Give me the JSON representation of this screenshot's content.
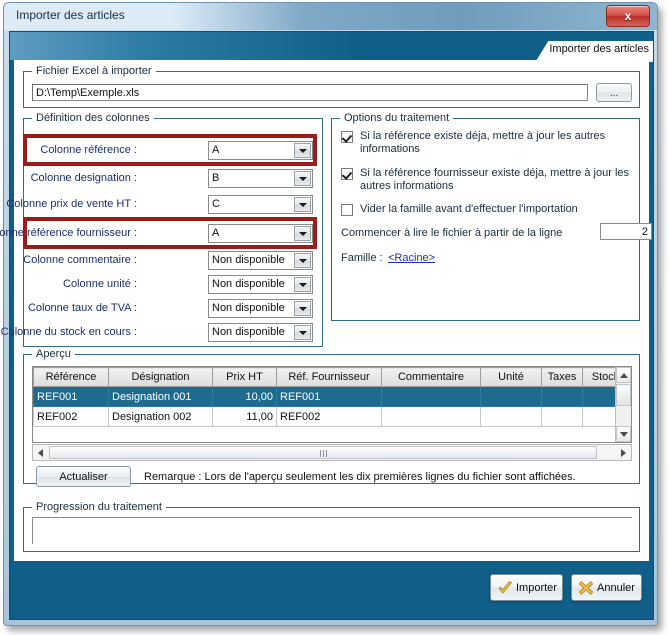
{
  "window": {
    "title": "Importer des articles",
    "close_label": "×",
    "tab_label": "Importer des articles"
  },
  "file_group": {
    "legend": "Fichier Excel à importer",
    "path_value": "D:\\Temp\\Exemple.xls",
    "browse_label": "..."
  },
  "columns_group": {
    "legend": "Définition des colonnes",
    "rows": [
      {
        "label": "Colonne référence :",
        "value": "A",
        "highlighted": true
      },
      {
        "label": "Colonne designation :",
        "value": "B",
        "highlighted": false
      },
      {
        "label": "Colonne prix de vente HT :",
        "value": "C",
        "highlighted": false
      },
      {
        "label": "Colonne référence fournisseur :",
        "value": "A",
        "highlighted": true
      },
      {
        "label": "Colonne commentaire :",
        "value": "Non disponible",
        "highlighted": false
      },
      {
        "label": "Colonne unité :",
        "value": "Non disponible",
        "highlighted": false
      },
      {
        "label": "Colonne taux de TVA :",
        "value": "Non disponible",
        "highlighted": false
      },
      {
        "label": "Colonne du stock en cours :",
        "value": "Non disponible",
        "highlighted": false
      }
    ]
  },
  "options_group": {
    "legend": "Options du traitement",
    "checkboxes": [
      {
        "label": "Si la référence existe déja, mettre à jour les autres informations",
        "checked": true
      },
      {
        "label": "Si la référence fournisseur existe déja, mettre à jour les autres informations",
        "checked": true
      },
      {
        "label": "Vider la famille avant d'effectuer l'importation",
        "checked": false
      }
    ],
    "start_line_label": "Commencer à lire le fichier à partir de la ligne",
    "start_line_value": "2",
    "famille_label": "Famille :",
    "famille_value": "<Racine>"
  },
  "preview_group": {
    "legend": "Aperçu",
    "headers": [
      "Référence",
      "Désignation",
      "Prix HT",
      "Réf. Fournisseur",
      "Commentaire",
      "Unité",
      "Taxes",
      "Stock"
    ],
    "rows": [
      {
        "selected": true,
        "cells": [
          "REF001",
          "Designation 001",
          "10,00",
          "REF001",
          "",
          "",
          "",
          ""
        ]
      },
      {
        "selected": false,
        "cells": [
          "REF002",
          "Designation 002",
          "11,00",
          "REF002",
          "",
          "",
          "",
          ""
        ]
      }
    ],
    "refresh_label": "Actualiser",
    "remark": "Remarque : Lors de l'aperçu seulement les dix premières lignes du fichier sont affichées."
  },
  "progress_group": {
    "legend": "Progression du traitement",
    "value": ""
  },
  "footer": {
    "import_label": "Importer",
    "cancel_label": "Annuler"
  },
  "colors": {
    "accent_blue": "#0f5f88",
    "highlight_red": "#9e1b1b",
    "selection_blue": "#1f6b8e",
    "link_blue": "#1b34a8",
    "label_navy": "#1b2f6e",
    "icon_gold": "#f2c14a"
  }
}
